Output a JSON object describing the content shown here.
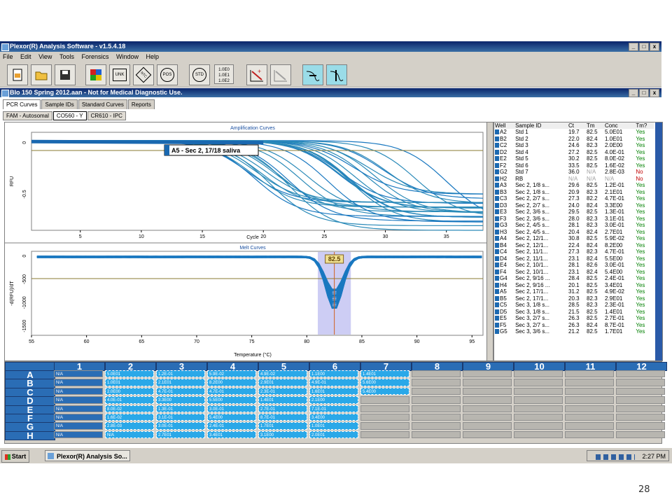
{
  "app": {
    "title": "Plexor(R) Analysis Software - v1.5.4.18",
    "window_buttons": [
      "_",
      "□",
      "x"
    ]
  },
  "menu": [
    "File",
    "Edit",
    "View",
    "Tools",
    "Forensics",
    "Window",
    "Help"
  ],
  "toolbar": {
    "buttons": [
      {
        "icon": "new-document-icon",
        "label": ""
      },
      {
        "icon": "open-folder-icon",
        "label": ""
      },
      {
        "icon": "save-icon",
        "label": ""
      },
      {
        "icon": "color-grid-icon",
        "label": ""
      },
      {
        "icon": "unknown-sample-icon",
        "label": "UNK"
      },
      {
        "icon": "ntc-icon",
        "label": "NTC"
      },
      {
        "icon": "positive-control-icon",
        "label": "POS"
      },
      {
        "icon": "standard-icon",
        "label": "STD"
      },
      {
        "icon": "concentration-list-icon",
        "label": "1.0E0\n1.0E1\n1.0E2"
      },
      {
        "icon": "curve-fit-icon",
        "label": ""
      },
      {
        "icon": "curve-fit-alt-icon",
        "label": ""
      },
      {
        "icon": "threshold-icon",
        "label": ""
      },
      {
        "icon": "threshold-alt-icon",
        "label": ""
      }
    ]
  },
  "document": {
    "title": "BIo 150 Spring 2012.aan - Not for Medical Diagnostic Use."
  },
  "tabs": [
    "PCR Curves",
    "Sample IDs",
    "Standard Curves",
    "Reports"
  ],
  "active_tab": "PCR Curves",
  "channel_tabs": [
    "FAM - Autosomal",
    "CO560 - Y",
    "CR610 - IPC"
  ],
  "active_channel": "CO560 - Y",
  "amplification": {
    "title": "Amplification Curves",
    "ylabel": "RFU",
    "xlabel": "Cycle",
    "tooltip": "A5 - Sec 2, 17/18 saliva",
    "xticks": [
      "5",
      "10",
      "15",
      "20",
      "25",
      "30",
      "35"
    ],
    "yticks": [
      "0",
      "-0.5"
    ]
  },
  "melt": {
    "title": "Melt Curves",
    "ylabel": "-d(RFU)/dT",
    "xlabel": "Temperature (°C)",
    "marker": "82.5",
    "xticks": [
      "55",
      "60",
      "65",
      "70",
      "75",
      "80",
      "85",
      "90",
      "95"
    ],
    "yticks": [
      "0",
      "-500",
      "-1000",
      "-1500"
    ]
  },
  "chart_data": [
    {
      "type": "line",
      "title": "Amplification Curves",
      "xlabel": "Cycle",
      "ylabel": "RFU",
      "xlim": [
        1,
        38
      ],
      "ylim": [
        -0.85,
        0.1
      ],
      "note_series": "multiple sigmoidal decreasing curves, one per well",
      "series_midpoints_ct": [
        19.7,
        22.0,
        24.6,
        27.2,
        30.2,
        33.5,
        36.0,
        29.6,
        20.9,
        27.3,
        24.0,
        29.5,
        28.0,
        28.1,
        20.4,
        30.8,
        22.4,
        27.3,
        23.1,
        28.1,
        23.1,
        28.4,
        20.1,
        31.2,
        20.3,
        28.5,
        21.5,
        26.3,
        21.2
      ]
    },
    {
      "type": "line",
      "title": "Melt Curves",
      "xlabel": "Temperature (°C)",
      "ylabel": "-d(RFU)/dT",
      "xlim": [
        55,
        96
      ],
      "ylim": [
        -1700,
        100
      ],
      "peak_temperature": 82.5,
      "peak_range": [
        81,
        84
      ],
      "peak_depth_range": [
        -700,
        -1150
      ]
    }
  ],
  "well_table": {
    "headers": [
      "Well",
      "Sample ID",
      "Ct",
      "Tm",
      "Conc",
      "Tm?"
    ],
    "rows": [
      [
        "A2",
        "Std 1",
        "19.7",
        "82.5",
        "5.0E01",
        "Yes"
      ],
      [
        "B2",
        "Std 2",
        "22.0",
        "82.4",
        "1.0E01",
        "Yes"
      ],
      [
        "C2",
        "Std 3",
        "24.6",
        "82.3",
        "2.0E00",
        "Yes"
      ],
      [
        "D2",
        "Std 4",
        "27.2",
        "82.5",
        "4.0E-01",
        "Yes"
      ],
      [
        "E2",
        "Std 5",
        "30.2",
        "82.5",
        "8.0E-02",
        "Yes"
      ],
      [
        "F2",
        "Std 6",
        "33.5",
        "82.5",
        "1.6E-02",
        "Yes"
      ],
      [
        "G2",
        "Std 7",
        "36.0",
        "N/A",
        "2.8E-03",
        "No"
      ],
      [
        "H2",
        "RB",
        "N/A",
        "N/A",
        "N/A",
        "No"
      ],
      [
        "A3",
        "Sec 2, 1/8 s...",
        "29.6",
        "82.5",
        "1.2E-01",
        "Yes"
      ],
      [
        "B3",
        "Sec 2, 1/8 s...",
        "20.9",
        "82.3",
        "2.1E01",
        "Yes"
      ],
      [
        "C3",
        "Sec 2, 2/7 s...",
        "27.3",
        "82.2",
        "4.7E-01",
        "Yes"
      ],
      [
        "D3",
        "Sec 2, 2/7 s...",
        "24.0",
        "82.4",
        "3.3E00",
        "Yes"
      ],
      [
        "E3",
        "Sec 2, 3/6 s...",
        "29.5",
        "82.5",
        "1.3E-01",
        "Yes"
      ],
      [
        "F3",
        "Sec 2, 3/6 s...",
        "28.0",
        "82.3",
        "3.1E-01",
        "Yes"
      ],
      [
        "G3",
        "Sec 2, 4/5 s...",
        "28.1",
        "82.3",
        "3.0E-01",
        "Yes"
      ],
      [
        "H3",
        "Sec 2, 4/5 s...",
        "20.4",
        "82.4",
        "2.7E01",
        "Yes"
      ],
      [
        "A4",
        "Sec 2, 12/1...",
        "30.8",
        "82.5",
        "5.9E-02",
        "Yes"
      ],
      [
        "B4",
        "Sec 2, 12/1...",
        "22.4",
        "82.4",
        "8.2E00",
        "Yes"
      ],
      [
        "C4",
        "Sec 2, 11/1...",
        "27.3",
        "82.3",
        "4.7E-01",
        "Yes"
      ],
      [
        "D4",
        "Sec 2, 11/1...",
        "23.1",
        "82.4",
        "5.5E00",
        "Yes"
      ],
      [
        "E4",
        "Sec 2, 10/1...",
        "28.1",
        "82.6",
        "3.0E-01",
        "Yes"
      ],
      [
        "F4",
        "Sec 2, 10/1...",
        "23.1",
        "82.4",
        "5.4E00",
        "Yes"
      ],
      [
        "G4",
        "Sec 2, 9/16 ...",
        "28.4",
        "82.5",
        "2.4E-01",
        "Yes"
      ],
      [
        "H4",
        "Sec 2, 9/16 ...",
        "20.1",
        "82.5",
        "3.4E01",
        "Yes"
      ],
      [
        "A5",
        "Sec 2, 17/1...",
        "31.2",
        "82.5",
        "4.9E-02",
        "Yes"
      ],
      [
        "B5",
        "Sec 2, 17/1...",
        "20.3",
        "82.3",
        "2.9E01",
        "Yes"
      ],
      [
        "C5",
        "Sec 3, 1/8 s...",
        "28.5",
        "82.3",
        "2.3E-01",
        "Yes"
      ],
      [
        "D5",
        "Sec 3, 1/8 s...",
        "21.5",
        "82.5",
        "1.4E01",
        "Yes"
      ],
      [
        "E5",
        "Sec 3, 2/7 s...",
        "26.3",
        "82.5",
        "2.7E-01",
        "Yes"
      ],
      [
        "F5",
        "Sec 3, 2/7 s...",
        "26.3",
        "82.4",
        "8.7E-01",
        "Yes"
      ],
      [
        "G5",
        "Sec 3, 3/6 s...",
        "21.2",
        "82.5",
        "1.7E01",
        "Yes"
      ]
    ]
  },
  "plate": {
    "columns": [
      "1",
      "2",
      "3",
      "4",
      "5",
      "6",
      "7",
      "8",
      "9",
      "10",
      "11",
      "12"
    ],
    "rows": [
      "A",
      "B",
      "C",
      "D",
      "E",
      "F",
      "G",
      "H"
    ],
    "col1": [
      "N/A",
      "N/A",
      "N/A",
      "N/A",
      "N/A",
      "N/A",
      "N/A",
      "N/A"
    ],
    "values": [
      [
        "5.0E01",
        "1.2E-01",
        "5.9E-02",
        "4.9E-02",
        "1.1E00",
        "1.4E01"
      ],
      [
        "1.0E01",
        "2.1E01",
        "8.2E00",
        "2.9E01",
        "4.9E-01",
        "5.6E00"
      ],
      [
        "2.0E00",
        "4.7E-01",
        "4.7E-01",
        "2.3E-01",
        "1.6E01",
        "5.4E00"
      ],
      [
        "4.0E-01",
        "3.3E00",
        "5.5E00",
        "1.4E01",
        "2.1E00",
        ""
      ],
      [
        "8.0E-02",
        "1.3E-01",
        "3.0E-01",
        "2.7E-01",
        "7.1E-01",
        ""
      ],
      [
        "1.6E-02",
        "3.1E-01",
        "5.4E00",
        "8.7E-01",
        "3.4E00",
        ""
      ],
      [
        "2.8E-03",
        "3.0E-01",
        "2.4E-01",
        "1.7E01",
        "1.0E01",
        ""
      ],
      [
        "N/A",
        "2.7E01",
        "3.4E01",
        "3.1E00",
        "2.0E01",
        ""
      ]
    ]
  },
  "taskbar": {
    "start": "Start",
    "item": "Plexor(R) Analysis So...",
    "clock": "2:27 PM"
  },
  "page_number": "28"
}
